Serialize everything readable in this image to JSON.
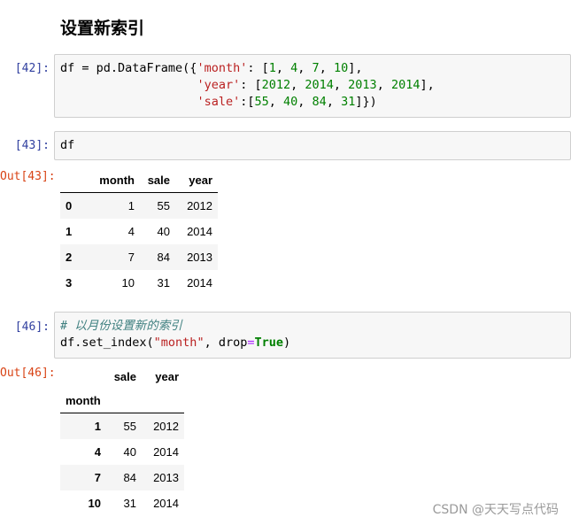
{
  "heading": "设置新索引",
  "cells": {
    "c42": {
      "in_prompt": "[42]:",
      "line1_a": "df = pd.DataFrame({",
      "line1_key": "'month'",
      "line1_b": ": [",
      "line1_vals": [
        "1",
        "4",
        "7",
        "10"
      ],
      "line2_key": "'year'",
      "line2_vals": [
        "2012",
        "2014",
        "2013",
        "2014"
      ],
      "line3_key": "'sale'",
      "line3_vals": [
        "55",
        "40",
        "84",
        "31"
      ]
    },
    "c43": {
      "in_prompt": "[43]:",
      "code": "df",
      "out_prompt": "Out[43]:"
    },
    "c46": {
      "in_prompt": "[46]:",
      "comment": "# 以月份设置新的索引",
      "code_a": "df.set_index(",
      "code_str": "\"month\"",
      "code_b": ", drop",
      "code_eq": "=",
      "code_kw": "True",
      "code_c": ")",
      "out_prompt": "Out[46]:"
    }
  },
  "table1": {
    "columns": [
      "",
      "month",
      "sale",
      "year"
    ],
    "rows": [
      [
        "0",
        "1",
        "55",
        "2012"
      ],
      [
        "1",
        "4",
        "40",
        "2014"
      ],
      [
        "2",
        "7",
        "84",
        "2013"
      ],
      [
        "3",
        "10",
        "31",
        "2014"
      ]
    ]
  },
  "table2": {
    "columns": [
      "",
      "sale",
      "year"
    ],
    "index_name": "month",
    "rows": [
      [
        "1",
        "55",
        "2012"
      ],
      [
        "4",
        "40",
        "2014"
      ],
      [
        "7",
        "84",
        "2013"
      ],
      [
        "10",
        "31",
        "2014"
      ]
    ]
  },
  "watermark": "CSDN @天天写点代码"
}
